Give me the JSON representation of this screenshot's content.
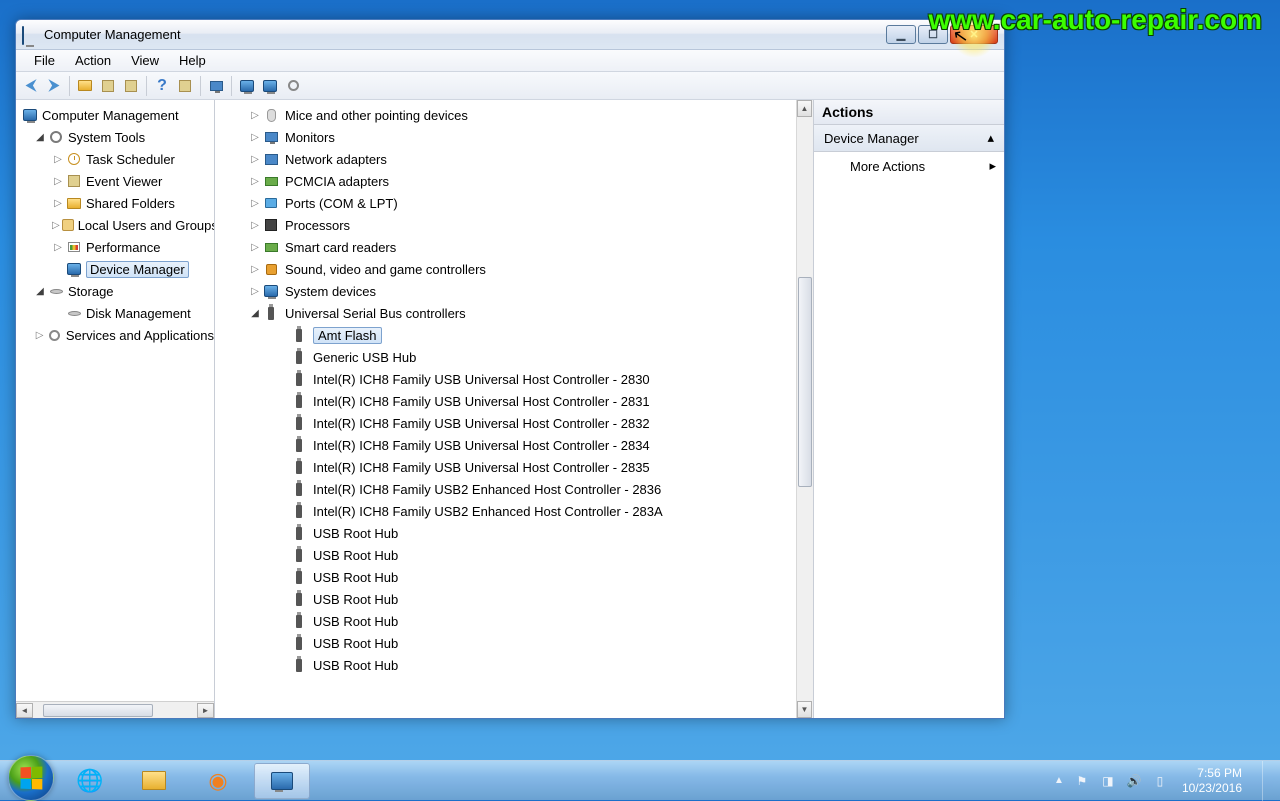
{
  "watermark": "www.car-auto-repair.com",
  "window": {
    "title": "Computer Management"
  },
  "menu": {
    "file": "File",
    "action": "Action",
    "view": "View",
    "help": "Help"
  },
  "left_tree": {
    "root": "Computer Management",
    "system_tools": "System Tools",
    "task_scheduler": "Task Scheduler",
    "event_viewer": "Event Viewer",
    "shared_folders": "Shared Folders",
    "local_users": "Local Users and Groups",
    "performance": "Performance",
    "device_manager": "Device Manager",
    "storage": "Storage",
    "disk_management": "Disk Management",
    "services": "Services and Applications"
  },
  "devices": {
    "mice": "Mice and other pointing devices",
    "monitors": "Monitors",
    "network": "Network adapters",
    "pcmcia": "PCMCIA adapters",
    "ports": "Ports (COM & LPT)",
    "processors": "Processors",
    "smartcard": "Smart card readers",
    "sound": "Sound, video and game controllers",
    "system": "System devices",
    "usb": "Universal Serial Bus controllers",
    "usb_items": [
      "Amt Flash",
      "Generic USB Hub",
      "Intel(R) ICH8 Family USB Universal Host Controller - 2830",
      "Intel(R) ICH8 Family USB Universal Host Controller - 2831",
      "Intel(R) ICH8 Family USB Universal Host Controller - 2832",
      "Intel(R) ICH8 Family USB Universal Host Controller - 2834",
      "Intel(R) ICH8 Family USB Universal Host Controller - 2835",
      "Intel(R) ICH8 Family USB2 Enhanced Host Controller - 2836",
      "Intel(R) ICH8 Family USB2 Enhanced Host Controller - 283A",
      "USB Root Hub",
      "USB Root Hub",
      "USB Root Hub",
      "USB Root Hub",
      "USB Root Hub",
      "USB Root Hub",
      "USB Root Hub"
    ]
  },
  "actions": {
    "header": "Actions",
    "section": "Device Manager",
    "more": "More Actions"
  },
  "tray": {
    "time": "7:56 PM",
    "date": "10/23/2016"
  }
}
